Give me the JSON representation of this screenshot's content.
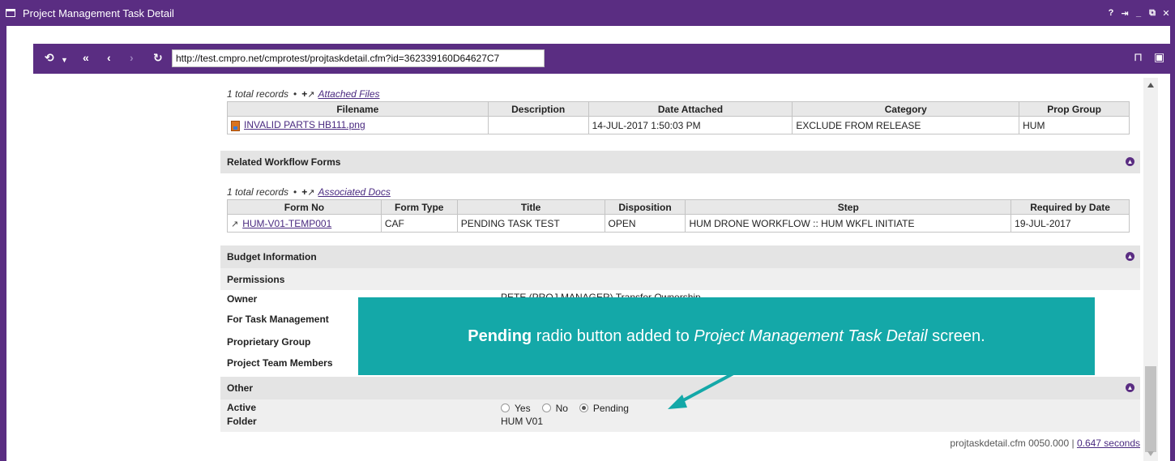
{
  "window": {
    "title": "Project Management Task Detail",
    "controls": [
      "?",
      "⇥",
      "_",
      "⧉",
      "✕"
    ]
  },
  "toolbar": {
    "url": "http://test.cmpro.net/cmprotest/projtaskdetail.cfm?id=362339160D64627C7"
  },
  "attached_files": {
    "records_text": "1 total records",
    "separator": "•",
    "link_label": "Attached Files",
    "columns": [
      "Filename",
      "Description",
      "Date Attached",
      "Category",
      "Prop Group"
    ],
    "rows": [
      {
        "filename": "INVALID PARTS HB111.png",
        "description": "",
        "date": "14-JUL-2017 1:50:03 PM",
        "category": "EXCLUDE FROM RELEASE",
        "prop_group": "HUM"
      }
    ]
  },
  "workflow": {
    "section_label": "Related Workflow Forms",
    "records_text": "1 total records",
    "separator": "•",
    "link_label": "Associated Docs",
    "columns": [
      "Form No",
      "Form Type",
      "Title",
      "Disposition",
      "Step",
      "Required by Date"
    ],
    "rows": [
      {
        "form_no": "HUM-V01-TEMP001",
        "form_type": "CAF",
        "title": "PENDING TASK TEST",
        "disposition": "OPEN",
        "step": "HUM DRONE WORKFLOW :: HUM WKFL INITIATE",
        "required_by": "19-JUL-2017"
      }
    ]
  },
  "budget": {
    "section_label": "Budget Information"
  },
  "permissions": {
    "label": "Permissions",
    "owner_label": "Owner",
    "owner_value": "PETE (PROJ MANAGER) Transfer Ownership",
    "task_mgmt_label": "For Task Management",
    "prop_group_label": "Proprietary Group",
    "team_label": "Project Team Members"
  },
  "other": {
    "section_label": "Other",
    "active_label": "Active",
    "radio_yes": "Yes",
    "radio_no": "No",
    "radio_pending": "Pending",
    "folder_label": "Folder",
    "folder_value": "HUM V01"
  },
  "footer": {
    "page_info": "projtaskdetail.cfm 0050.000  |  ",
    "timing": "0.647 seconds"
  },
  "callout": {
    "bold": "Pending",
    "middle": " radio button added to ",
    "italic": "Project Management Task Detail",
    "end": " screen."
  },
  "colors": {
    "accent": "#5a2d82",
    "callout": "#14a8a8"
  }
}
